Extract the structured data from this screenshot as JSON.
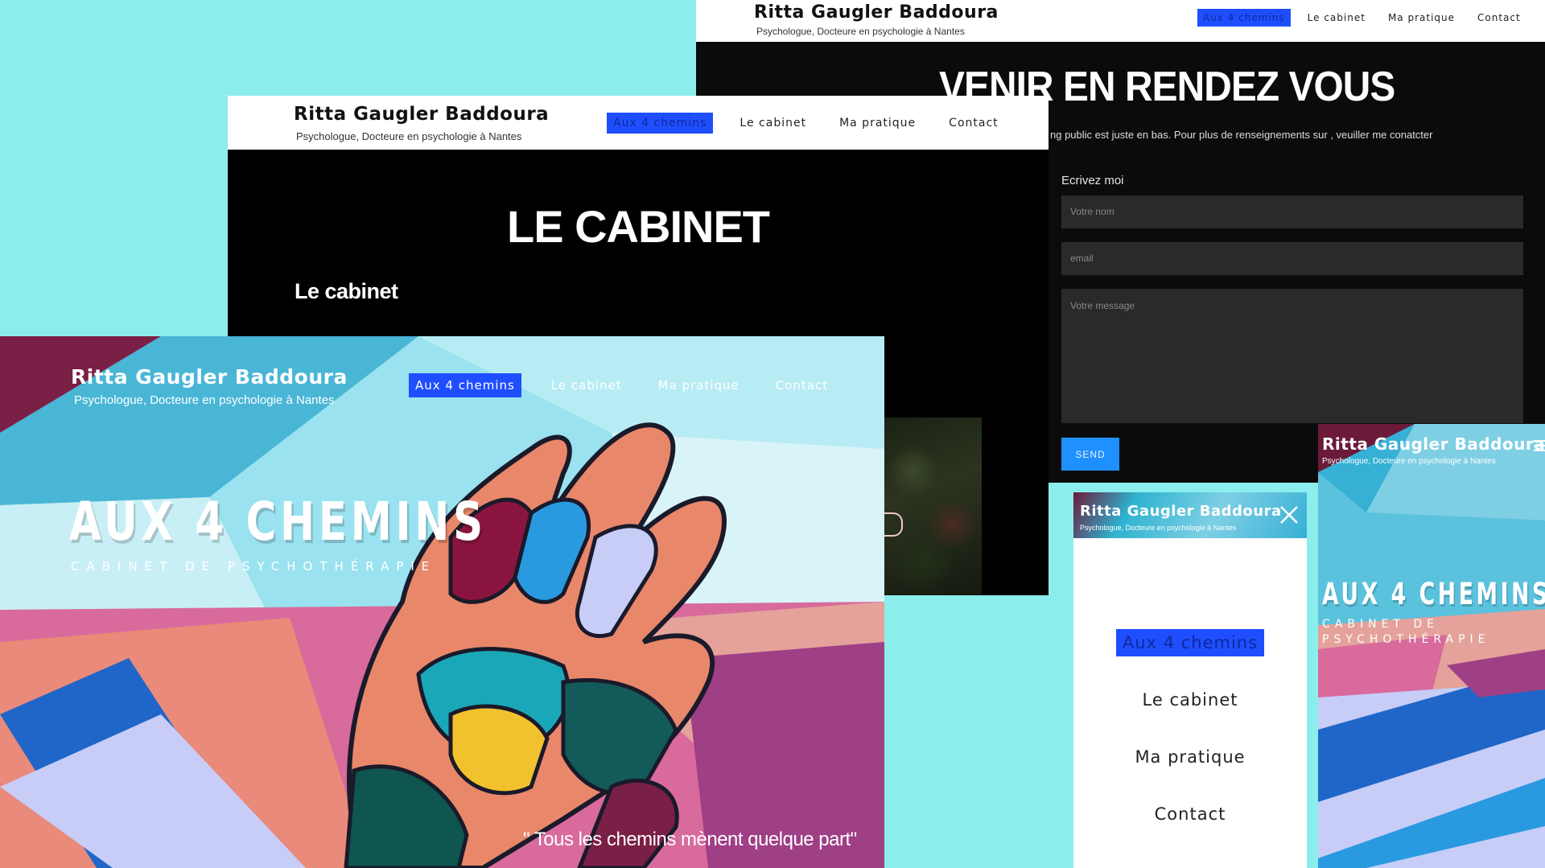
{
  "brand": {
    "name": "Ritta Gaugler Baddoura",
    "subtitle": "Psychologue, Docteure en psychologie à Nantes"
  },
  "nav": {
    "items": [
      "Aux 4 chemins",
      "Le cabinet",
      "Ma pratique",
      "Contact"
    ],
    "active": "Aux 4 chemins"
  },
  "contact_page": {
    "title": "VENIR EN RENDEZ VOUS",
    "intro": "ng public est juste en bas. Pour plus de renseignements sur , veuiller me conatcter",
    "form_title": "Ecrivez moi",
    "name_placeholder": "Votre nom",
    "email_placeholder": "email",
    "message_placeholder": "Votre message",
    "send_label": "SEND"
  },
  "cabinet_page": {
    "title": "LE CABINET",
    "subtitle": "Le cabinet"
  },
  "hero_page": {
    "title": "AUX 4 CHEMINS",
    "subtitle": "CABINET DE PSYCHOTHÉRAPIE",
    "quote": "\" Tous les chemins mènent quelque part\""
  },
  "mobile_hero": {
    "title": "AUX 4 CHEMINS",
    "subtitle": "CABINET DE PSYCHOTHÉRAPIE"
  },
  "colors": {
    "background": "#8beeec",
    "accent_active": "#1f4eff",
    "send_button": "#1e90ff",
    "dark_page": "#0b0b0b"
  },
  "icons": [
    "close-icon",
    "hamburger-menu-icon"
  ]
}
